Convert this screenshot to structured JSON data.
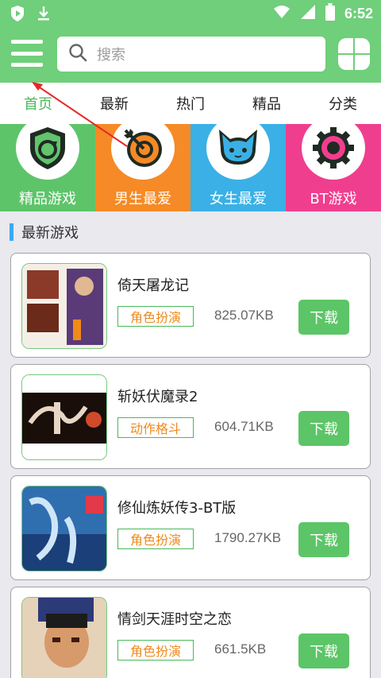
{
  "status_bar": {
    "time": "6:52",
    "left_icons": [
      "shield-play-icon",
      "download-icon"
    ],
    "right_icons": [
      "wifi-icon",
      "signal-icon",
      "battery-icon"
    ]
  },
  "header": {
    "search_placeholder": "搜索",
    "brand_color": "#6fcf7a"
  },
  "tabs": [
    {
      "label": "首页",
      "active": true
    },
    {
      "label": "最新",
      "active": false
    },
    {
      "label": "热门",
      "active": false
    },
    {
      "label": "精品",
      "active": false
    },
    {
      "label": "分类",
      "active": false
    }
  ],
  "categories": [
    {
      "label": "精品游戏",
      "color": "#5ec46a",
      "icon": "shield-refresh-icon"
    },
    {
      "label": "男生最爱",
      "color": "#f58a26",
      "icon": "target-arrow-icon"
    },
    {
      "label": "女生最爱",
      "color": "#3ab0e6",
      "icon": "cat-face-icon"
    },
    {
      "label": "BT游戏",
      "color": "#f03e8e",
      "icon": "gear-icon"
    }
  ],
  "section": {
    "title": "最新游戏"
  },
  "games": [
    {
      "name": "倚天屠龙记",
      "tag": "角色扮演",
      "size": "825.07KB",
      "download": "下载"
    },
    {
      "name": "斩妖伏魔录2",
      "tag": "动作格斗",
      "size": "604.71KB",
      "download": "下载"
    },
    {
      "name": "修仙炼妖传3-BT版",
      "tag": "角色扮演",
      "size": "1790.27KB",
      "download": "下载"
    },
    {
      "name": "情剑天涯时空之恋",
      "tag": "角色扮演",
      "size": "661.5KB",
      "download": "下载"
    }
  ]
}
